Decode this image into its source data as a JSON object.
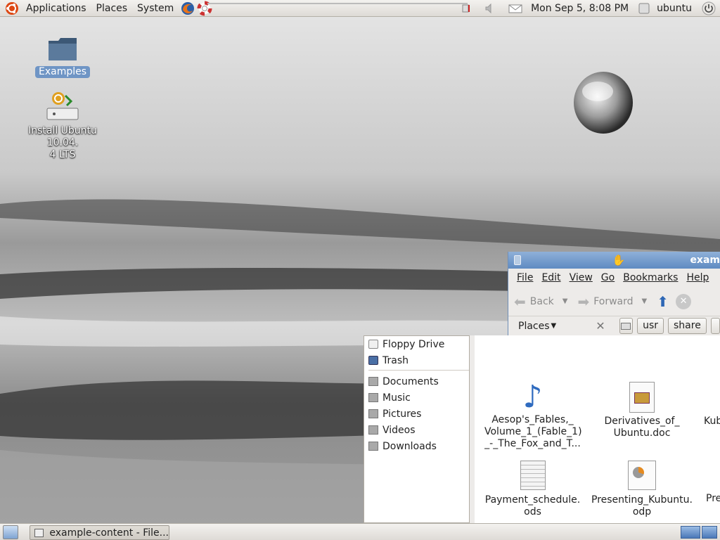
{
  "top_panel": {
    "menus": [
      "Applications",
      "Places",
      "System"
    ],
    "clock": "Mon Sep  5,  8:08 PM",
    "user": "ubuntu"
  },
  "desktop": {
    "icons": [
      {
        "label": "Examples",
        "icon": "folder-icon"
      },
      {
        "label": "Install Ubuntu 10.04.\n4 LTS",
        "icon": "install-icon"
      }
    ]
  },
  "window": {
    "title": "exam",
    "menus": [
      "File",
      "Edit",
      "View",
      "Go",
      "Bookmarks",
      "Help"
    ],
    "toolbar": {
      "back": "Back",
      "forward": "Forward"
    },
    "places_label": "Places",
    "path": [
      "usr",
      "share"
    ]
  },
  "sidebar": {
    "devices": [
      {
        "label": "Floppy Drive",
        "icon": "floppy-icon"
      },
      {
        "label": "Trash",
        "icon": "trash-icon"
      }
    ],
    "bookmarks": [
      {
        "label": "Documents",
        "icon": "folder-icon"
      },
      {
        "label": "Music",
        "icon": "folder-icon"
      },
      {
        "label": "Pictures",
        "icon": "folder-icon"
      },
      {
        "label": "Videos",
        "icon": "folder-icon"
      },
      {
        "label": "Downloads",
        "icon": "folder-icon"
      }
    ]
  },
  "files": [
    {
      "label": "Aesop's_Fables,_\nVolume_1_(Fable_1)\n_-_The_Fox_and_T...",
      "icon": "music-note-icon"
    },
    {
      "label": "Derivatives_of_\nUbuntu.doc",
      "icon": "document-icon"
    },
    {
      "label": "Kub",
      "icon": "document-icon"
    },
    {
      "label": "Payment_schedule.\nods",
      "icon": "spreadsheet-icon"
    },
    {
      "label": "Presenting_Kubuntu.\nodp",
      "icon": "presentation-icon"
    },
    {
      "label": "Pre",
      "icon": "document-icon"
    }
  ],
  "taskbar": {
    "task": "example-content - File..."
  },
  "colors": {
    "panel": "#dedbd6",
    "selection": "#6f95c5",
    "titlebar": "#5f8bc2"
  }
}
